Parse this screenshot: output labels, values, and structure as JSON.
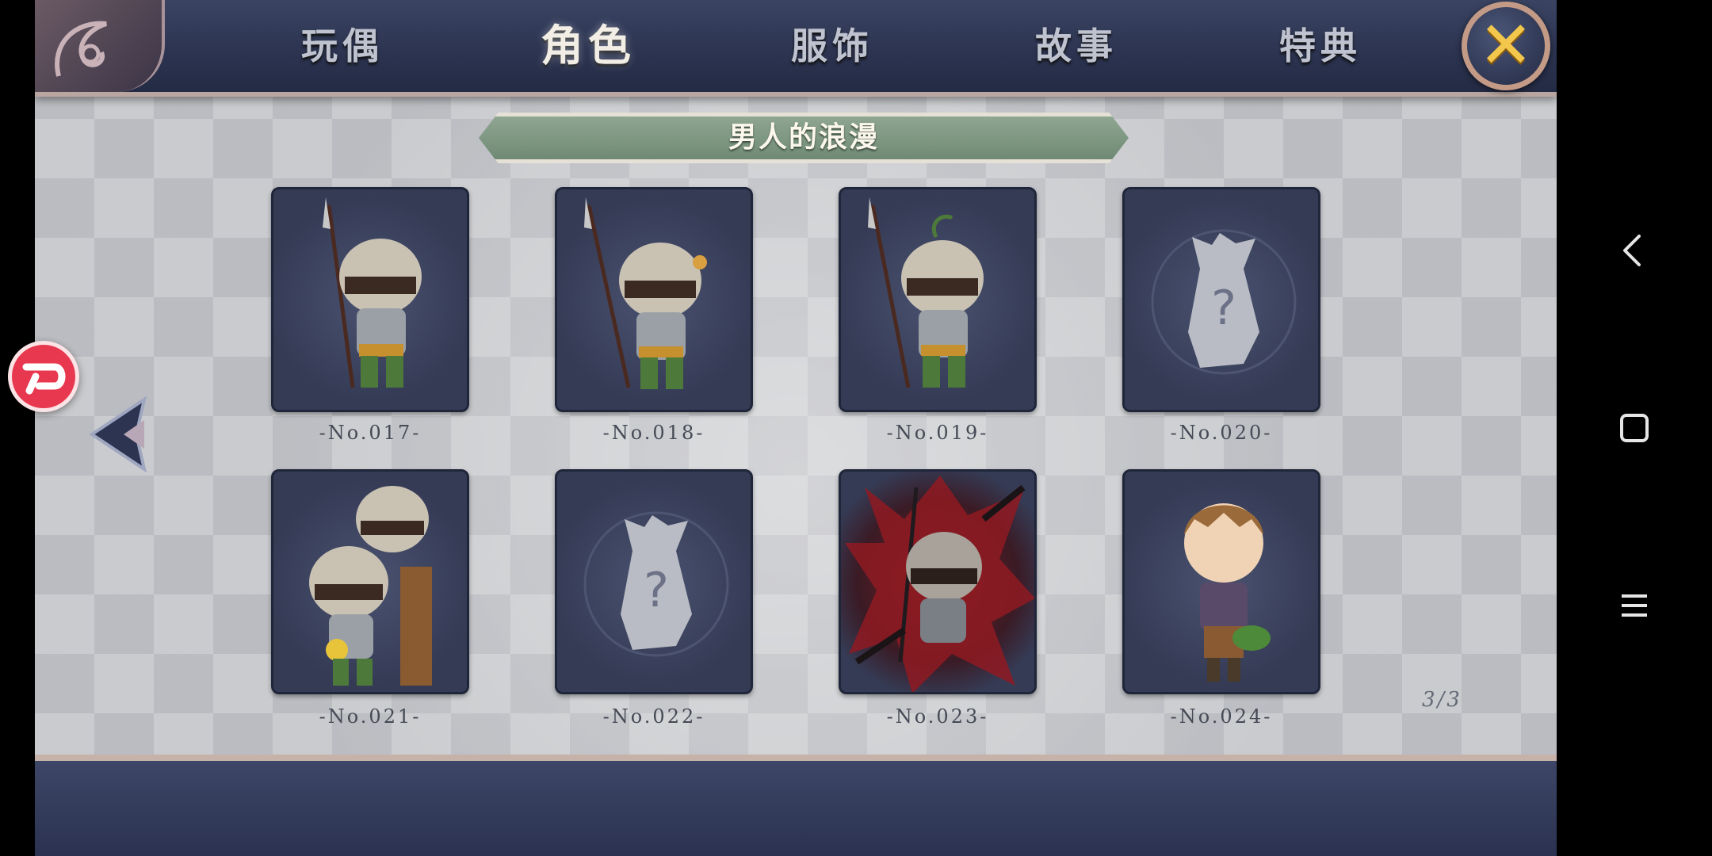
{
  "tabs": [
    {
      "label": "玩偶",
      "active": false
    },
    {
      "label": "角色",
      "active": true
    },
    {
      "label": "服饰",
      "active": false
    },
    {
      "label": "故事",
      "active": false
    },
    {
      "label": "特典",
      "active": false
    }
  ],
  "close_icon": "close-icon",
  "title": "男人的浪漫",
  "cards": [
    {
      "label": "-No.017-",
      "image": "spear-soldier-portrait"
    },
    {
      "label": "-No.018-",
      "image": "spear-soldier-portrait"
    },
    {
      "label": "-No.019-",
      "image": "spear-soldier-portrait"
    },
    {
      "label": "-No.020-",
      "image": "locked-mystery-icon"
    },
    {
      "label": "-No.021-",
      "image": "two-soldiers-portrait"
    },
    {
      "label": "-No.022-",
      "image": "locked-mystery-icon"
    },
    {
      "label": "-No.023-",
      "image": "soldier-red-burst-portrait"
    },
    {
      "label": "-No.024-",
      "image": "boy-with-frog-portrait"
    }
  ],
  "page_indicator": "3/3",
  "colors": {
    "accent_gold": "#f2c74c",
    "banner_green": "#7f9983",
    "card_bg": "#3e4561",
    "badge_red": "#e8384f"
  }
}
